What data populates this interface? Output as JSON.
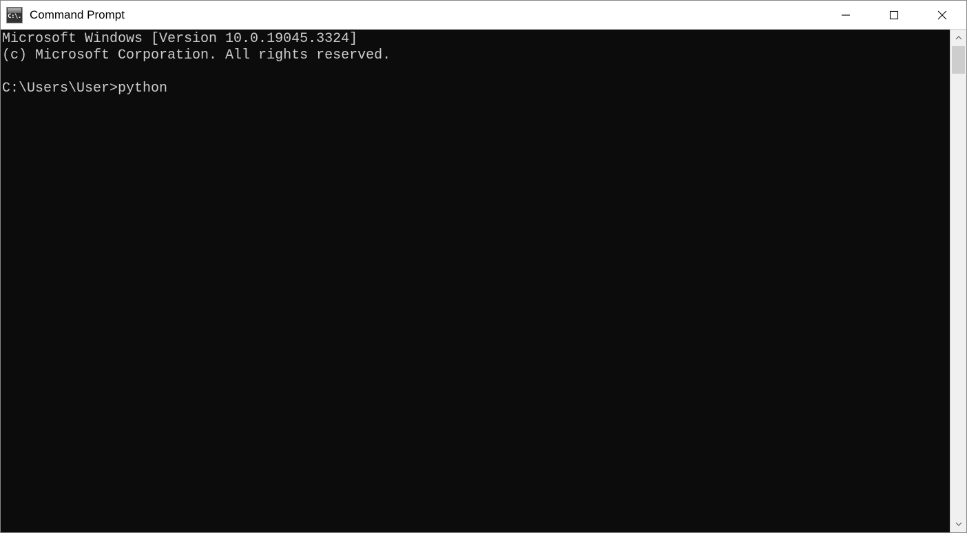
{
  "window": {
    "title": "Command Prompt",
    "icon_label": "C:\\."
  },
  "terminal": {
    "line1": "Microsoft Windows [Version 10.0.19045.3324]",
    "line2": "(c) Microsoft Corporation. All rights reserved.",
    "prompt_path": "C:\\Users\\User>",
    "typed_command": "python"
  }
}
